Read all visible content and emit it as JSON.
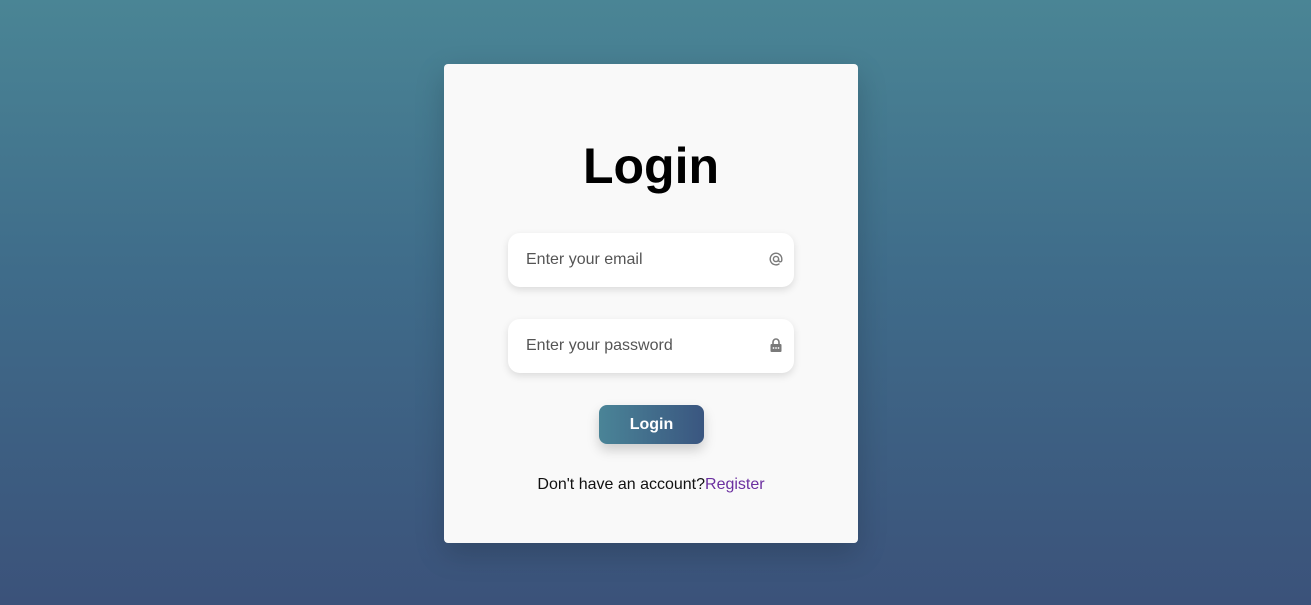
{
  "login_card": {
    "title": "Login",
    "email": {
      "placeholder": "Enter your email",
      "value": "",
      "icon": "at-sign-icon"
    },
    "password": {
      "placeholder": "Enter your password",
      "value": "",
      "icon": "lock-icon"
    },
    "submit_label": "Login",
    "register_prompt": "Don't have an account?",
    "register_link": "Register"
  },
  "colors": {
    "background_top": "#4a8595",
    "background_bottom": "#3b527a",
    "card": "#f9f9f9",
    "button_start": "#4a8497",
    "button_end": "#3a5680",
    "link": "#6b2fa0"
  }
}
